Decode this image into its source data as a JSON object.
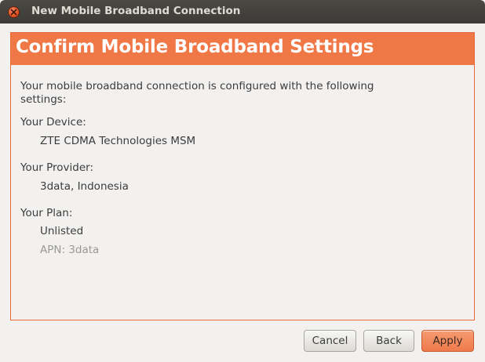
{
  "window": {
    "title": "New Mobile Broadband Connection"
  },
  "banner": {
    "title": "Confirm Mobile Broadband Settings"
  },
  "intro": {
    "line1": "Your mobile broadband connection is configured with the following",
    "line2": "settings:"
  },
  "device": {
    "label": "Your Device:",
    "value": "ZTE CDMA Technologies MSM"
  },
  "provider": {
    "label": "Your Provider:",
    "value": "3data, Indonesia"
  },
  "plan": {
    "label": "Your Plan:",
    "value": "Unlisted",
    "apn": "APN: 3data"
  },
  "buttons": {
    "cancel": "Cancel",
    "back": "Back",
    "apply": "Apply"
  },
  "colors": {
    "accent": "#f07746",
    "titlebar": "#3c3b37",
    "background": "#f2f1f0"
  }
}
